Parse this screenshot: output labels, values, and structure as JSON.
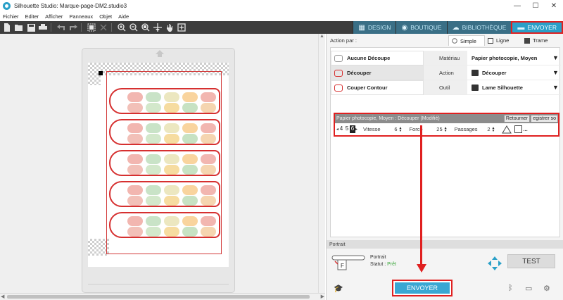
{
  "window": {
    "title": "Silhouette Studio: Marque-page-DM2.studio3",
    "minimize": "—",
    "maximize": "☐",
    "close": "✕"
  },
  "menu": [
    "Fichier",
    "Editer",
    "Afficher",
    "Panneaux",
    "Objet",
    "Aide"
  ],
  "tabs": {
    "design": "DESIGN",
    "boutique": "BOUTIQUE",
    "bibliotheque": "BIBLIOTHÈQUE",
    "envoyer": "ENVOYER"
  },
  "panel": {
    "action_par": "Action par :",
    "modes": {
      "simple": "Simple",
      "ligne": "Ligne",
      "trame": "Trame"
    },
    "actions": [
      "Aucune Découpe",
      "Découper",
      "Couper Contour"
    ],
    "materiau_label": "Matériau",
    "materiau_value": "Papier photocopie, Moyen",
    "action_label": "Action",
    "action_value": "Découper",
    "outil_label": "Outil",
    "outil_value": "Lame Silhouette",
    "settings_header": "Papier photocopie, Moyen : Découper (Modifié)",
    "retourner": "Retourner",
    "enregistrer": "egistrer so",
    "blade_digits": [
      "4",
      "5",
      "6"
    ],
    "vitesse_label": "Vitesse",
    "vitesse_value": "6",
    "force_label": "Force",
    "force_value": "25",
    "passages_label": "Passages",
    "passages_value": "2",
    "portrait_section": "Portrait",
    "portrait_text": "Portrait",
    "statut_label": "Statut :",
    "statut_value": "Prêt",
    "test": "TEST",
    "envoyer": "ENVOYER",
    "ellipsis": "..."
  },
  "colors": {
    "accent": "#2aa0c8",
    "highlight": "#e02020",
    "envoyer_button": "#3aa7d3",
    "status_ok": "#3aa63a"
  }
}
